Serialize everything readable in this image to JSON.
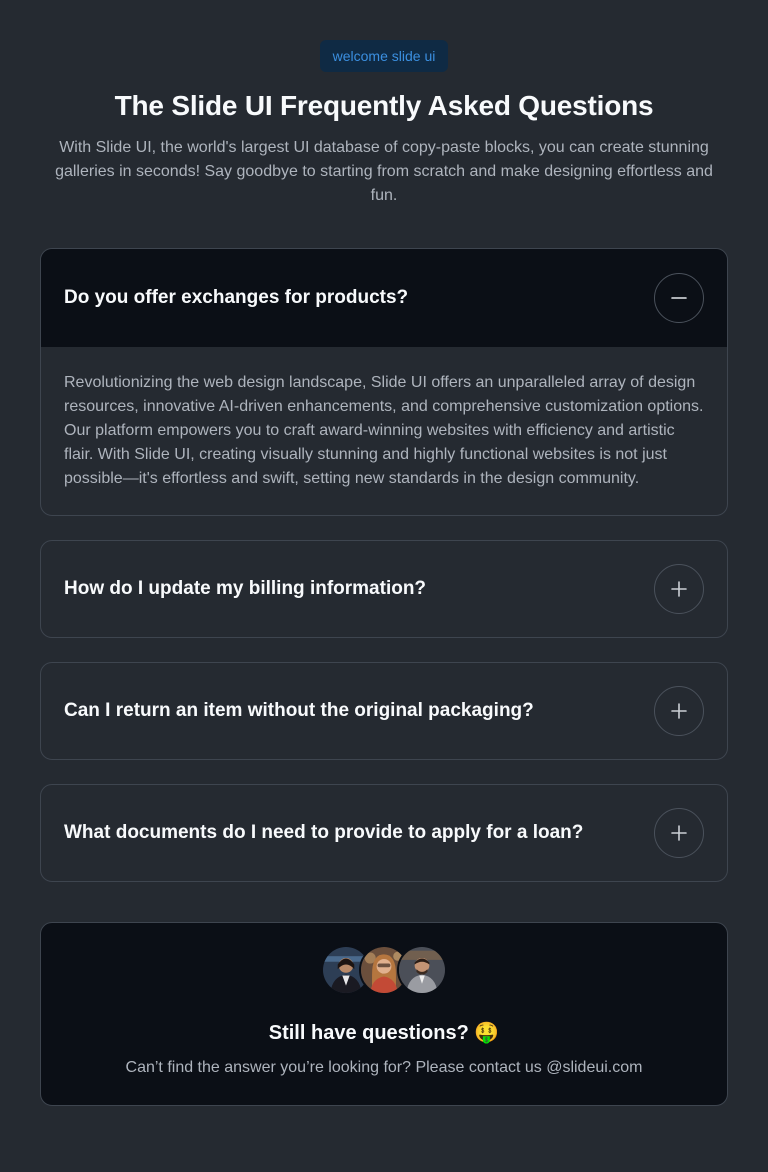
{
  "badge": "welcome slide ui",
  "title": "The Slide UI Frequently Asked Questions",
  "subtitle": "With Slide UI, the world's largest UI database of copy-paste blocks, you can create stunning galleries in seconds! Say goodbye to starting from scratch and make designing effortless and fun.",
  "faqs": [
    {
      "question": "Do you offer exchanges for products?",
      "answer": "Revolutionizing the web design landscape, Slide UI offers an unparalleled array of design resources, innovative AI-driven enhancements, and comprehensive customization options. Our platform empowers you to craft award-winning websites with efficiency and artistic flair. With Slide UI, creating visually stunning and highly functional websites is not just possible—it's effortless and swift, setting new standards in the design community.",
      "toggle_icon": "minus-icon"
    },
    {
      "question": "How do I update my billing information?",
      "toggle_icon": "plus-icon"
    },
    {
      "question": "Can I return an item without the original packaging?",
      "toggle_icon": "plus-icon"
    },
    {
      "question": "What documents do I need to provide to apply for a loan?",
      "toggle_icon": "plus-icon"
    }
  ],
  "contact": {
    "title": "Still have questions? 🤑",
    "text": "Can’t find the answer you’re looking for? Please contact us @slideui.com"
  },
  "colors": {
    "background": "#252a31",
    "panel": "#0b0f16",
    "badge_bg": "#0f2a44",
    "badge_text": "#3b8fe0",
    "border": "#3e454f"
  }
}
